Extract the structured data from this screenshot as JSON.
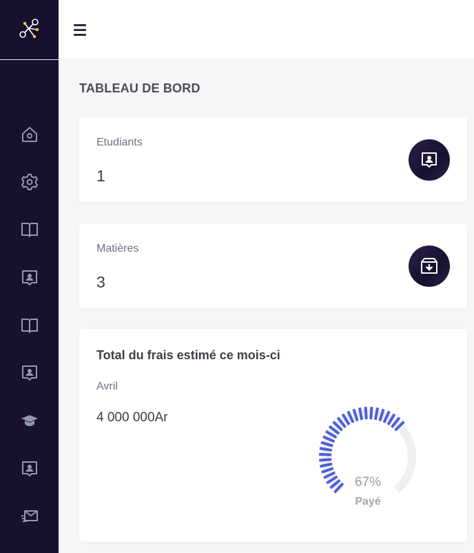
{
  "brand": {
    "icon": "network-nodes-icon"
  },
  "sidebar": {
    "items": [
      {
        "icon": "home-icon"
      },
      {
        "icon": "gear-icon"
      },
      {
        "icon": "book-open-icon"
      },
      {
        "icon": "user-badge-icon"
      },
      {
        "icon": "book-open-icon"
      },
      {
        "icon": "user-badge-icon"
      },
      {
        "icon": "graduation-cap-icon"
      },
      {
        "icon": "user-badge-icon"
      },
      {
        "icon": "mail-send-icon"
      }
    ]
  },
  "topbar": {
    "menu_icon": "hamburger-icon"
  },
  "page": {
    "title": "TABLEAU DE BORD"
  },
  "cards": {
    "students": {
      "label": "Etudiants",
      "value": "1",
      "icon": "user-badge-icon"
    },
    "subjects": {
      "label": "Matières",
      "value": "3",
      "icon": "archive-download-icon"
    }
  },
  "fees": {
    "title": "Total du frais estimé ce mois-ci",
    "month": "Avril",
    "amount": "4 000 000Ar",
    "gauge": {
      "percent": 67,
      "percent_label": "67%",
      "label": "Payé"
    }
  },
  "colors": {
    "sidebar_bg": "#17112f",
    "gauge_fill": "#4f5fd6",
    "gauge_track": "#efeff2",
    "page_bg": "#f6f6f9"
  }
}
